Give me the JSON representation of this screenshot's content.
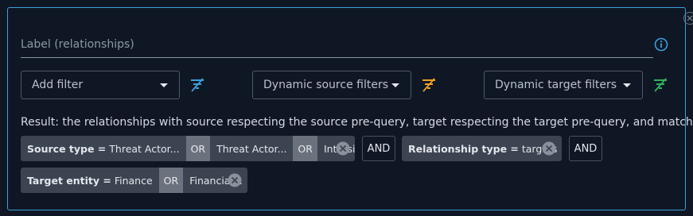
{
  "label_field": {
    "placeholder": "Label (relationships)"
  },
  "filters": {
    "add_filter": "Add filter",
    "dynamic_source": "Dynamic source filters",
    "dynamic_target": "Dynamic target filters"
  },
  "result_text": "Result: the relationships with source respecting the source pre-query, target respecting the target pre-query, and matching:",
  "chips": {
    "source_type": {
      "key": "Source type =",
      "values": [
        "Threat Actor...",
        "Threat Actor...",
        "Intrusion"
      ],
      "or": "OR"
    },
    "relationship_type": {
      "key": "Relationship type =",
      "value": "targets"
    },
    "target_entity": {
      "key": "Target entity =",
      "values": [
        "Finance",
        "Financial..."
      ],
      "or": "OR"
    },
    "and": "AND"
  },
  "colors": {
    "accent_blue": "#3aa0d8",
    "source_filter_icon": "#f0a020",
    "target_filter_icon": "#2fb35c"
  }
}
